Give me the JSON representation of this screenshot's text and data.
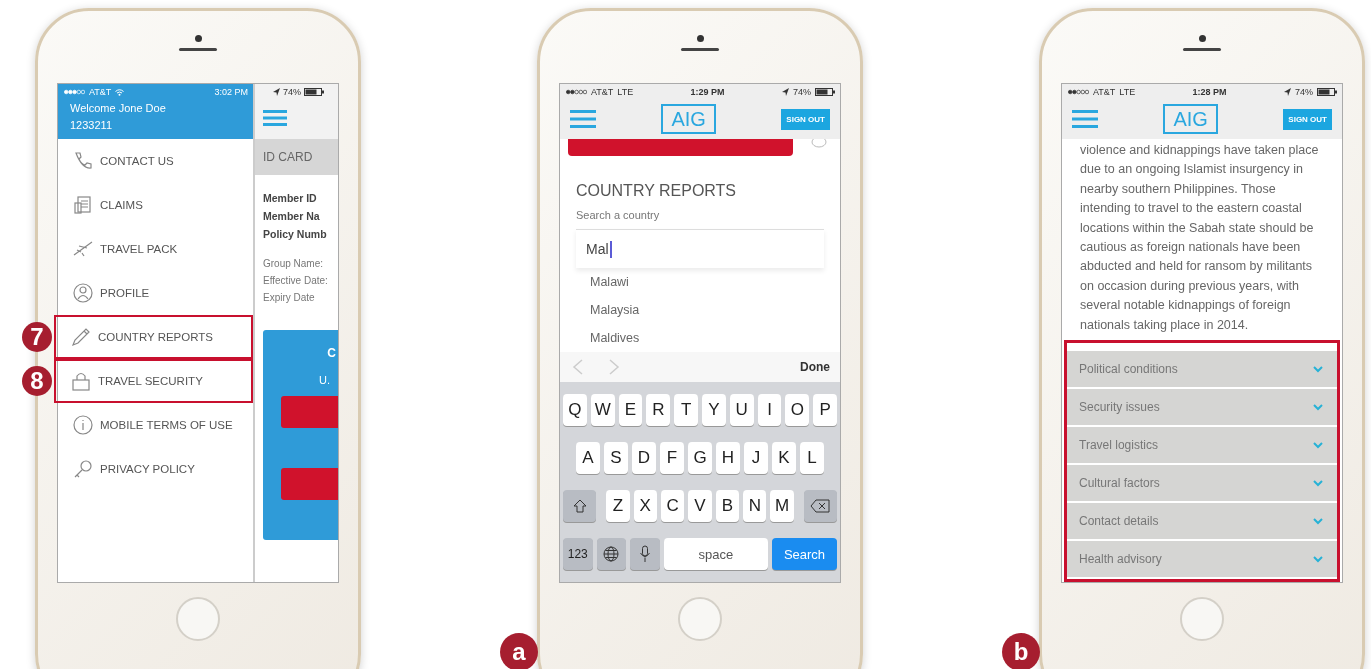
{
  "phones": [
    {
      "kind": "menu",
      "status": {
        "carrier": "AT&T",
        "time": "3:02 PM",
        "battery": "74%"
      },
      "welcome": "Welcome Jone Doe",
      "member_number": "1233211",
      "menu_items": [
        {
          "label": "CONTACT US",
          "highlighted": false
        },
        {
          "label": "CLAIMS",
          "highlighted": false
        },
        {
          "label": "TRAVEL PACK",
          "highlighted": false
        },
        {
          "label": "PROFILE",
          "highlighted": false
        },
        {
          "label": "COUNTRY REPORTS",
          "highlighted": true,
          "badge": "7"
        },
        {
          "label": "TRAVEL SECURITY",
          "highlighted": true,
          "badge": "8"
        },
        {
          "label": "MOBILE TERMS OF USE",
          "highlighted": false
        },
        {
          "label": "PRIVACY POLICY",
          "highlighted": false
        }
      ],
      "peek": {
        "tab": "ID CARD",
        "bold_lines": [
          "Member ID",
          "Member Na",
          "Policy Numb"
        ],
        "lines": [
          "Group Name:",
          "Effective Date:",
          "Expiry Date"
        ],
        "card_title": "C",
        "card_text": "U."
      }
    },
    {
      "kind": "search",
      "badge": "a",
      "status": {
        "carrier": "AT&T",
        "network": "LTE",
        "time": "1:29 PM",
        "battery": "74%"
      },
      "logo": "AIG",
      "sign_out": "SIGN OUT",
      "title": "COUNTRY REPORTS",
      "search_label": "Search a country",
      "search_value": "Mal",
      "suggestions": [
        "Malawi",
        "Malaysia",
        "Maldives"
      ],
      "done": "Done",
      "key_rows": [
        [
          "Q",
          "W",
          "E",
          "R",
          "T",
          "Y",
          "U",
          "I",
          "O",
          "P"
        ],
        [
          "A",
          "S",
          "D",
          "F",
          "G",
          "H",
          "J",
          "K",
          "L"
        ],
        [
          "Z",
          "X",
          "C",
          "V",
          "B",
          "N",
          "M"
        ]
      ],
      "numbers_key": "123",
      "space_key": "space",
      "search_key": "Search"
    },
    {
      "kind": "report",
      "badge": "b",
      "status": {
        "carrier": "AT&T",
        "network": "LTE",
        "time": "1:28 PM",
        "battery": "74%"
      },
      "logo": "AIG",
      "sign_out": "SIGN OUT",
      "body": "violence and kidnappings have taken place due to an ongoing Islamist insurgency in nearby southern Philippines. Those intending to travel to the eastern coastal locations within the Sabah state should be cautious as foreign nationals have been abducted and held for ransom by militants on occasion during previous years, with several notable kidnappings of foreign nationals taking place in 2014.",
      "sections": [
        {
          "label": "Political conditions",
          "expanded": false
        },
        {
          "label": "Security issues",
          "expanded": false
        },
        {
          "label": "Travel logistics",
          "expanded": false
        },
        {
          "label": "Cultural factors",
          "expanded": false
        },
        {
          "label": "Contact details",
          "expanded": false
        },
        {
          "label": "Health advisory",
          "expanded": false
        }
      ]
    }
  ]
}
